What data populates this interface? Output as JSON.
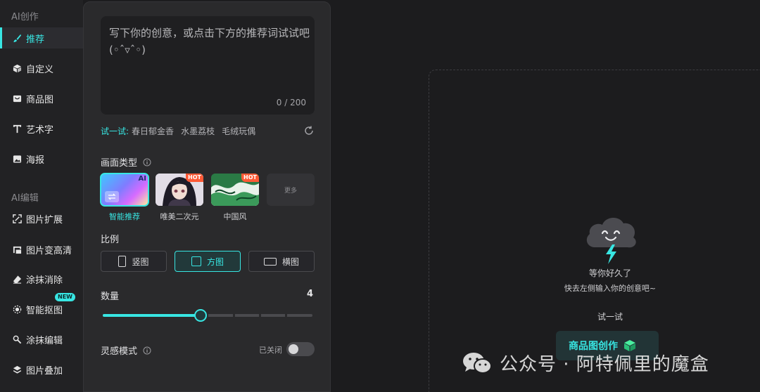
{
  "sidebar": {
    "section_create": "AI创作",
    "section_edit": "AI编辑",
    "items": [
      {
        "label": "推荐",
        "icon": "brush-icon"
      },
      {
        "label": "自定义",
        "icon": "cube-icon"
      },
      {
        "label": "商品图",
        "icon": "product-icon"
      },
      {
        "label": "艺术字",
        "icon": "text-art-icon"
      },
      {
        "label": "海报",
        "icon": "image-icon"
      },
      {
        "label": "图片扩展",
        "icon": "expand-icon"
      },
      {
        "label": "图片变高清",
        "icon": "hd-icon"
      },
      {
        "label": "涂抹消除",
        "icon": "eraser-icon"
      },
      {
        "label": "智能抠图",
        "icon": "cutout-icon",
        "badge": "NEW"
      },
      {
        "label": "涂抹编辑",
        "icon": "smear-edit-icon"
      },
      {
        "label": "图片叠加",
        "icon": "layers-icon"
      }
    ]
  },
  "prompt": {
    "placeholder": "写下你的创意，或点击下方的推荐词试试吧(◦ˆ▿ˆ◦)",
    "count": "0 / 200"
  },
  "suggestions": {
    "label": "试一试:",
    "chips": [
      "春日郁金香",
      "水墨荔枝",
      "毛绒玩偶"
    ]
  },
  "style_type": {
    "label": "画面类型",
    "options": [
      {
        "caption": "智能推荐",
        "badge": "AI",
        "selected": true
      },
      {
        "caption": "唯美二次元",
        "badge": "HOT"
      },
      {
        "caption": "中国风",
        "badge": "HOT"
      },
      {
        "caption": "",
        "more_label": "更多"
      }
    ]
  },
  "ratio": {
    "label": "比例",
    "options": [
      {
        "label": "竖图",
        "selected": false
      },
      {
        "label": "方图",
        "selected": true
      },
      {
        "label": "横图",
        "selected": false
      }
    ]
  },
  "quantity": {
    "label": "数量",
    "value": "4",
    "min": 1,
    "max": 8,
    "current": 4
  },
  "inspiration": {
    "label": "灵感模式",
    "status": "已关闭",
    "enabled": false
  },
  "canvas": {
    "line1": "等你好久了",
    "line2": "快去左侧输入你的创意吧~",
    "try_title": "试一试",
    "create_button": "商品图创作"
  },
  "watermark": {
    "text": "公众号 · 阿特佩里的魔盒"
  },
  "colors": {
    "accent": "#38e6e3",
    "hot": "#ff5a36",
    "background": "#1c1c1e",
    "panel": "#2a2a2c"
  }
}
